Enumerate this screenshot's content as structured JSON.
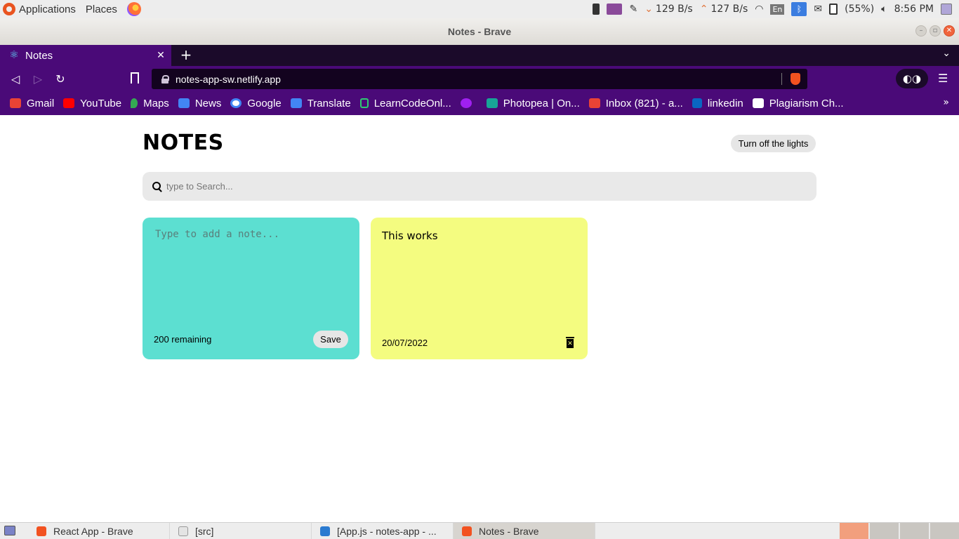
{
  "os_panel": {
    "menus": [
      "Applications",
      "Places"
    ],
    "net_down": "129 B/s",
    "net_up": "127 B/s",
    "keyboard": "En",
    "battery": "(55%)",
    "clock": "8:56 PM"
  },
  "window": {
    "title": "Notes - Brave"
  },
  "browser": {
    "tab_title": "Notes",
    "url": "notes-app-sw.netlify.app",
    "bookmarks": [
      {
        "label": "Gmail",
        "color": "#ea4335"
      },
      {
        "label": "YouTube",
        "color": "#ff0000"
      },
      {
        "label": "Maps",
        "color": "#34a853"
      },
      {
        "label": "News",
        "color": "#4285f4"
      },
      {
        "label": "Google",
        "color": "#ffffff"
      },
      {
        "label": "Translate",
        "color": "#4285f4"
      },
      {
        "label": "LearnCodeOnl...",
        "color": "#2ecc71"
      },
      {
        "label": "",
        "color": "#a020f0"
      },
      {
        "label": "Photopea | On...",
        "color": "#18a497"
      },
      {
        "label": "Inbox (821) - a...",
        "color": "#ea4335"
      },
      {
        "label": "linkedin",
        "color": "#0a66c2"
      },
      {
        "label": "Plagiarism Ch...",
        "color": "#ffffff"
      }
    ]
  },
  "app": {
    "title": "NOTES",
    "toggle_label": "Turn off the lights",
    "search_placeholder": "type to Search...",
    "new_note": {
      "placeholder": "Type to add a note...",
      "remaining": "200 remaining",
      "save_label": "Save",
      "color": "#5cdfd1"
    },
    "notes": [
      {
        "text": "This works",
        "date": "20/07/2022",
        "color": "#f4fc80"
      }
    ]
  },
  "taskbar": {
    "tasks": [
      {
        "label": "React App - Brave",
        "icon": "brave-icon"
      },
      {
        "label": "[src]",
        "icon": "folder-icon"
      },
      {
        "label": "[App.js - notes-app - ...",
        "icon": "vscode-icon"
      },
      {
        "label": "Notes - Brave",
        "icon": "brave-icon"
      }
    ]
  }
}
